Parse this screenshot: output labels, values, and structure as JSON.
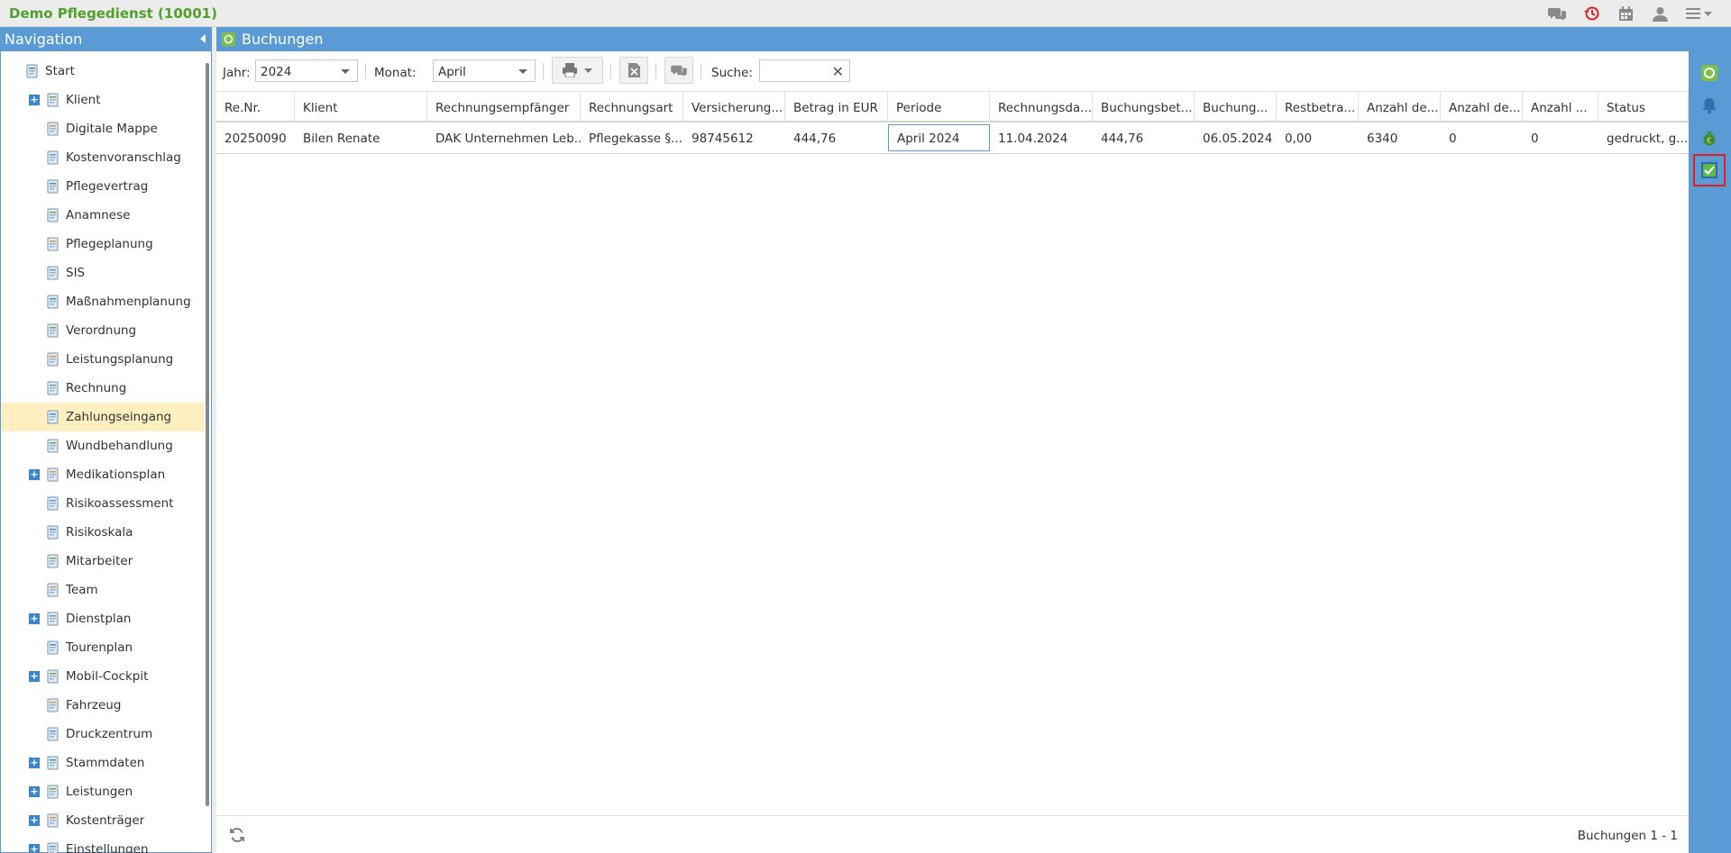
{
  "app": {
    "title": "Demo Pflegedienst (10001)"
  },
  "topbar": {
    "icons": [
      "chat-icon",
      "history-icon",
      "calendar-icon",
      "user-icon",
      "menu-icon"
    ]
  },
  "nav": {
    "title": "Navigation",
    "items": [
      {
        "label": "Start",
        "icon": "home-icon",
        "expandable": false,
        "root": true
      },
      {
        "label": "Klient",
        "icon": "clients-icon",
        "expandable": true
      },
      {
        "label": "Digitale Mappe",
        "icon": "folder-icon",
        "expandable": false
      },
      {
        "label": "Kostenvoranschlag",
        "icon": "calculator-icon",
        "expandable": false
      },
      {
        "label": "Pflegevertrag",
        "icon": "contract-icon",
        "expandable": false
      },
      {
        "label": "Anamnese",
        "icon": "clipboard-icon",
        "expandable": false
      },
      {
        "label": "Pflegeplanung",
        "icon": "care-plan-icon",
        "expandable": false
      },
      {
        "label": "SIS",
        "icon": "document-icon",
        "expandable": false
      },
      {
        "label": "Maßnahmenplanung",
        "icon": "clipboard-icon",
        "expandable": false
      },
      {
        "label": "Verordnung",
        "icon": "stethoscope-icon",
        "expandable": false
      },
      {
        "label": "Leistungsplanung",
        "icon": "clipboard-icon",
        "expandable": false
      },
      {
        "label": "Rechnung",
        "icon": "invoice-icon",
        "expandable": false
      },
      {
        "label": "Zahlungseingang",
        "icon": "payment-icon",
        "expandable": false,
        "active": true
      },
      {
        "label": "Wundbehandlung",
        "icon": "bandage-icon",
        "expandable": false
      },
      {
        "label": "Medikationsplan",
        "icon": "medication-icon",
        "expandable": true
      },
      {
        "label": "Risikoassessment",
        "icon": "magnifier-icon",
        "expandable": false
      },
      {
        "label": "Risikoskala",
        "icon": "magnifier-icon",
        "expandable": false
      },
      {
        "label": "Mitarbeiter",
        "icon": "employee-icon",
        "expandable": false
      },
      {
        "label": "Team",
        "icon": "team-icon",
        "expandable": false
      },
      {
        "label": "Dienstplan",
        "icon": "schedule-icon",
        "expandable": true
      },
      {
        "label": "Tourenplan",
        "icon": "route-icon",
        "expandable": false
      },
      {
        "label": "Mobil-Cockpit",
        "icon": "cloud-icon",
        "expandable": true
      },
      {
        "label": "Fahrzeug",
        "icon": "car-icon",
        "expandable": false
      },
      {
        "label": "Druckzentrum",
        "icon": "printer-icon",
        "expandable": false
      },
      {
        "label": "Stammdaten",
        "icon": "master-data-icon",
        "expandable": true
      },
      {
        "label": "Leistungen",
        "icon": "heart-icon",
        "expandable": true
      },
      {
        "label": "Kostenträger",
        "icon": "building-icon",
        "expandable": true
      },
      {
        "label": "Einstellungen",
        "icon": "gears-icon",
        "expandable": true
      }
    ]
  },
  "panel": {
    "title": "Buchungen",
    "toolbar": {
      "year_label": "Jahr:",
      "year_value": "2024",
      "month_label": "Monat:",
      "month_value": "April",
      "search_label": "Suche:",
      "search_value": ""
    },
    "columns": [
      "Re.Nr.",
      "Klient",
      "Rechnungsempfänger",
      "Rechnungsart",
      "Versicherung...",
      "Betrag in EUR",
      "Periode",
      "Rechnungsda...",
      "Buchungsbet...",
      "Buchung...",
      "Restbetra...",
      "Anzahl de...",
      "Anzahl de...",
      "Anzahl ...",
      "Status"
    ],
    "rows": [
      [
        "20250090",
        "Bilen Renate",
        "DAK Unternehmen Leb...",
        "Pflegekasse §...",
        "98745612",
        "444,76",
        "April 2024",
        "11.04.2024",
        "444,76",
        "06.05.2024",
        "0,00",
        "6340",
        "0",
        "0",
        "gedruckt, g..."
      ]
    ],
    "footer_text": "Buchungen 1 - 1"
  },
  "rail": {
    "icons": [
      "payment-icon",
      "bell-icon",
      "money-bag-icon",
      "checklist-icon"
    ],
    "selected": "checklist-icon"
  },
  "colors": {
    "accent": "#5b9bd5",
    "title_green": "#4fa12b",
    "active_row": "#fdefc0",
    "highlight_red": "#e02020"
  }
}
